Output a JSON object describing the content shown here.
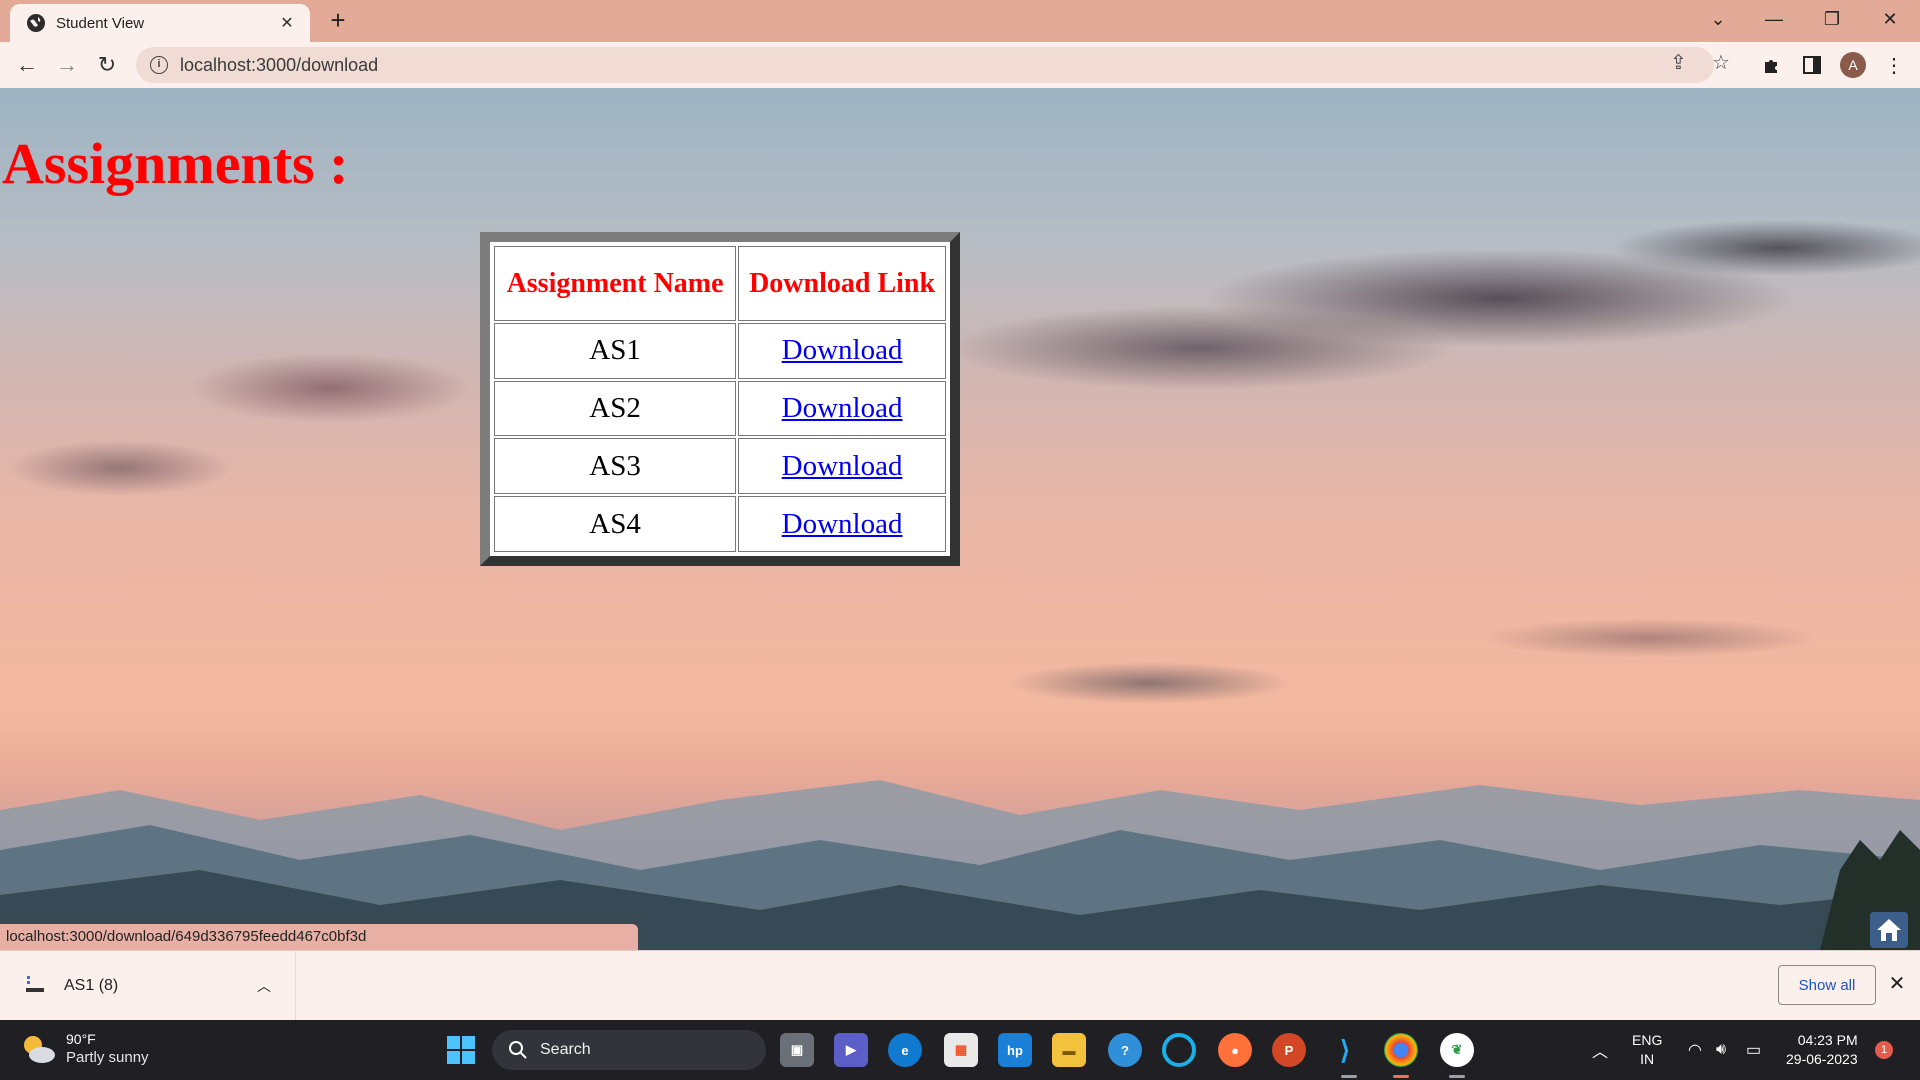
{
  "browser": {
    "tab_title": "Student View",
    "url": "localhost:3000/download",
    "profile_initial": "A"
  },
  "page": {
    "heading": "Assignments :",
    "table": {
      "headers": [
        "Assignment Name",
        "Download Link"
      ],
      "rows": [
        {
          "name": "AS1",
          "link_text": "Download"
        },
        {
          "name": "AS2",
          "link_text": "Download"
        },
        {
          "name": "AS3",
          "link_text": "Download"
        },
        {
          "name": "AS4",
          "link_text": "Download"
        }
      ]
    },
    "status_url": "localhost:3000/download/649d336795feedd467c0bf3d"
  },
  "download_shelf": {
    "item_name": "AS1 (8)",
    "show_all_label": "Show all"
  },
  "taskbar": {
    "weather_temp": "90°F",
    "weather_desc": "Partly sunny",
    "search_label": "Search",
    "lang_line1": "ENG",
    "lang_line2": "IN",
    "time": "04:23 PM",
    "date": "29-06-2023",
    "notification_count": "1"
  },
  "colors": {
    "heading": "#ff0000",
    "link": "#0000ee",
    "chrome": "#e4aa98",
    "taskbar": "#1f1f24"
  }
}
